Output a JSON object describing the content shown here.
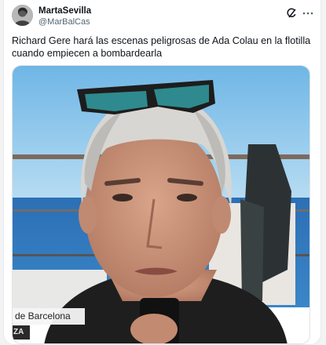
{
  "tweet": {
    "display_name": "MartaSevilla",
    "handle": "@MarBalCas",
    "text": "Richard Gere hará las escenas peligrosas de Ada Colau en la flotilla cuando empiecen a bombardearla"
  },
  "media": {
    "caption_primary": "de Barcelona",
    "caption_secondary": "ZA"
  },
  "icons": {
    "grok": "grok-icon",
    "more": "more-icon"
  },
  "colors": {
    "text": "#0f1419",
    "secondary_text": "#536471",
    "sky": "#8ec8ea",
    "sea": "#2f73b8"
  }
}
